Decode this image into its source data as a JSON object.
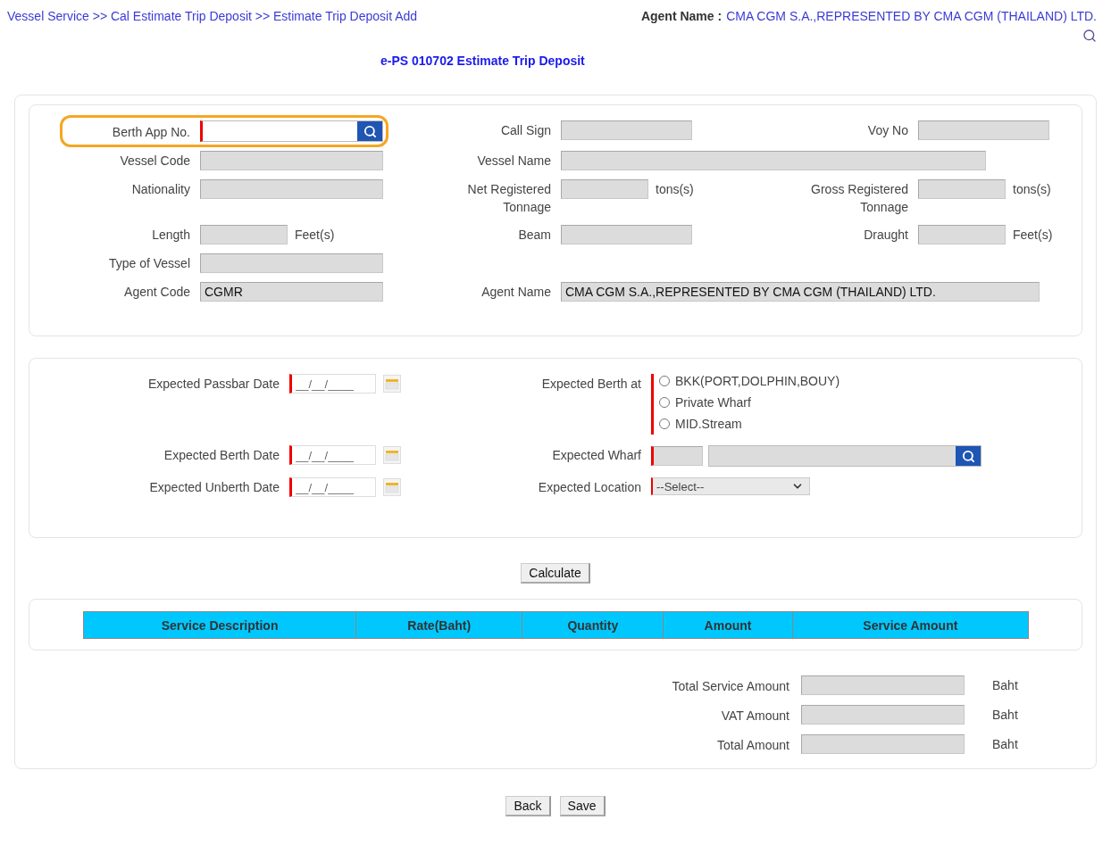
{
  "breadcrumb": "Vessel Service >> Cal Estimate Trip Deposit >> Estimate Trip Deposit Add",
  "agent": {
    "label": "Agent Name :",
    "value": "CMA CGM S.A.,REPRESENTED BY CMA CGM (THAILAND) LTD."
  },
  "title": "e-PS 010702 Estimate Trip Deposit",
  "vessel_form": {
    "rows": [
      [
        {
          "label": "Berth App No.",
          "kind": "search",
          "required": true,
          "editable": true,
          "highlighted": true
        },
        {
          "label": "Call Sign",
          "kind": "text",
          "editable": false
        },
        {
          "label": "Voy No",
          "kind": "text",
          "editable": false
        }
      ],
      [
        {
          "label": "Vessel Code",
          "kind": "text",
          "editable": false
        },
        {
          "label": "Vessel Name",
          "kind": "text",
          "editable": false
        }
      ],
      [
        {
          "label": "Nationality",
          "kind": "text",
          "editable": false
        },
        {
          "label": "Net Registered Tonnage",
          "kind": "text",
          "editable": false,
          "unit": "tons(s)"
        },
        {
          "label": "Gross Registered Tonnage",
          "kind": "text",
          "editable": false,
          "unit": "tons(s)"
        }
      ],
      [
        {
          "label": "Length",
          "kind": "text",
          "editable": false,
          "unit": "Feet(s)"
        },
        {
          "label": "Beam",
          "kind": "text",
          "editable": false
        },
        {
          "label": "Draught",
          "kind": "text",
          "editable": false,
          "unit": "Feet(s)"
        }
      ],
      [
        {
          "label": "Type of Vessel",
          "kind": "text",
          "editable": false
        }
      ],
      [
        {
          "label": "Agent Code",
          "kind": "text",
          "editable": false,
          "value": "CGMR"
        },
        {
          "label": "Agent Name",
          "kind": "text",
          "editable": false,
          "value": "CMA CGM S.A.,REPRESENTED BY CMA CGM (THAILAND) LTD."
        }
      ]
    ]
  },
  "schedule_form": {
    "rows": [
      {
        "left": {
          "label": "Expected Passbar Date",
          "placeholder": "__/__/____",
          "required": true
        },
        "right": {
          "label": "Expected Berth at",
          "kind": "radio",
          "required": true,
          "options": [
            {
              "label": "BKK(PORT,DOLPHIN,BOUY)",
              "selected": false
            },
            {
              "label": "Private Wharf",
              "selected": false
            },
            {
              "label": "MID.Stream",
              "selected": false
            }
          ]
        }
      },
      {
        "left": {
          "label": "Expected Berth Date",
          "placeholder": "__/__/____",
          "required": true
        },
        "right": {
          "label": "Expected Wharf",
          "kind": "wharf",
          "required": true
        }
      },
      {
        "left": {
          "label": "Expected Unberth Date",
          "placeholder": "__/__/____",
          "required": true
        },
        "right": {
          "label": "Expected Location",
          "kind": "select",
          "required": true,
          "value": "--Select--"
        }
      }
    ]
  },
  "calculate_button": "Calculate",
  "table": {
    "columns": [
      "Service Description",
      "Rate(Baht)",
      "Quantity",
      "Amount",
      "Service Amount"
    ]
  },
  "totals": [
    {
      "label": "Total Service Amount",
      "unit": "Baht"
    },
    {
      "label": "VAT Amount",
      "unit": "Baht"
    },
    {
      "label": "Total Amount",
      "unit": "Baht"
    }
  ],
  "buttons": [
    "Back",
    "Save"
  ]
}
